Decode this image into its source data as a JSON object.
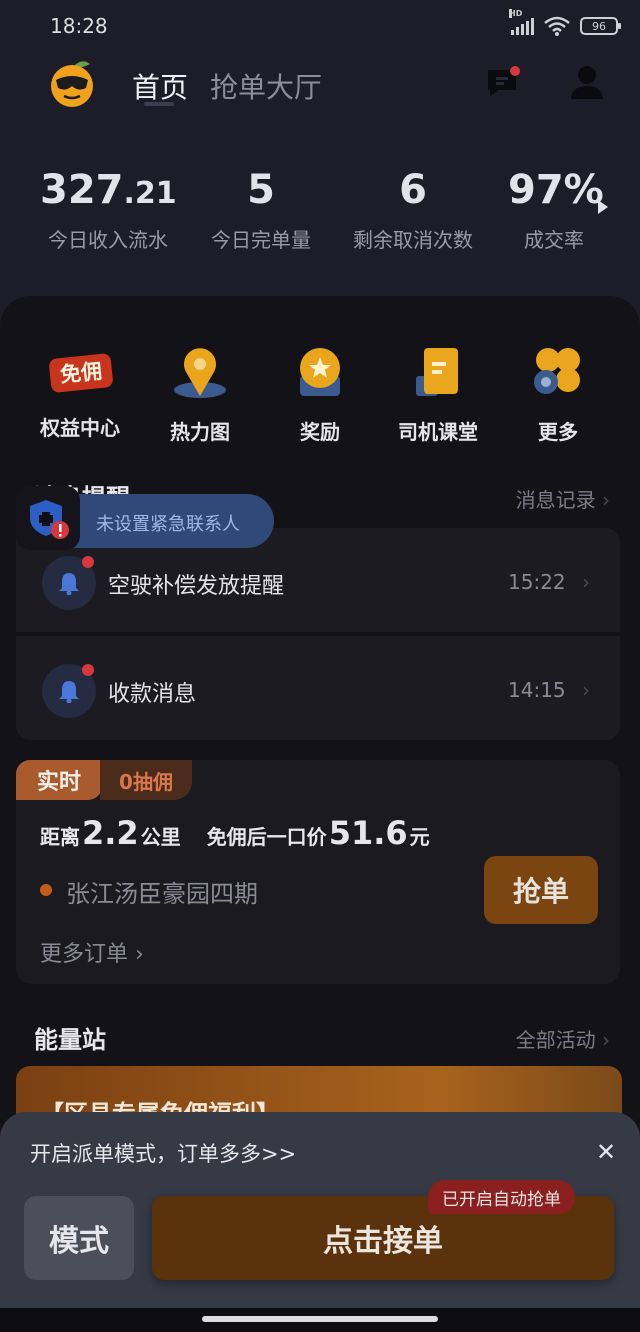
{
  "status_bar": {
    "time": "18:28",
    "network": "HD",
    "battery": "96"
  },
  "header": {
    "tab_home": "首页",
    "tab_hall": "抢单大厅"
  },
  "stats": [
    {
      "value_int": "327",
      "value_dec": ".21",
      "label": "今日收入流水"
    },
    {
      "value_int": "5",
      "value_dec": "",
      "label": "今日完单量"
    },
    {
      "value_int": "6",
      "value_dec": "",
      "label": "剩余取消次数"
    },
    {
      "value_int": "97%",
      "value_dec": "",
      "label": "成交率"
    }
  ],
  "quick_menu": [
    {
      "label": "权益中心",
      "icon": "commission-free-icon",
      "badge_text": "免佣"
    },
    {
      "label": "热力图",
      "icon": "map-pin-icon"
    },
    {
      "label": "奖励",
      "icon": "reward-star-icon"
    },
    {
      "label": "司机课堂",
      "icon": "book-icon"
    },
    {
      "label": "更多",
      "icon": "more-circles-icon"
    }
  ],
  "messages": {
    "title": "消息提醒",
    "record_link": "消息记录",
    "toast": "未设置紧急联系人",
    "items": [
      {
        "text": "空驶补偿发放提醒",
        "time": "15:22"
      },
      {
        "text": "收款消息",
        "time": "14:15"
      }
    ]
  },
  "order": {
    "tag_live": "实时",
    "tag_commission": "0抽佣",
    "distance_prefix": "距离",
    "distance_value": "2.2",
    "distance_unit": "公里",
    "price_prefix": "免佣后一口价",
    "price_value": "51.6",
    "price_unit": "元",
    "address": "张江汤臣豪园四期",
    "grab_button": "抢单",
    "more_orders": "更多订单 ›"
  },
  "energy": {
    "title": "能量站",
    "all_link": "全部活动",
    "banner_text": "【区县专属免佣福利】"
  },
  "bottom_sheet": {
    "prompt": "开启派单模式，订单多多>>",
    "close": "✕",
    "mode_button": "模式",
    "accept_button": "点击接单",
    "auto_badge": "已开启自动抢单"
  },
  "colors": {
    "background": "#1d1d2a",
    "panel": "#131317",
    "accent_orange": "#a95a2f",
    "grab_button": "#7a4511",
    "alert_red": "#d9373e"
  }
}
